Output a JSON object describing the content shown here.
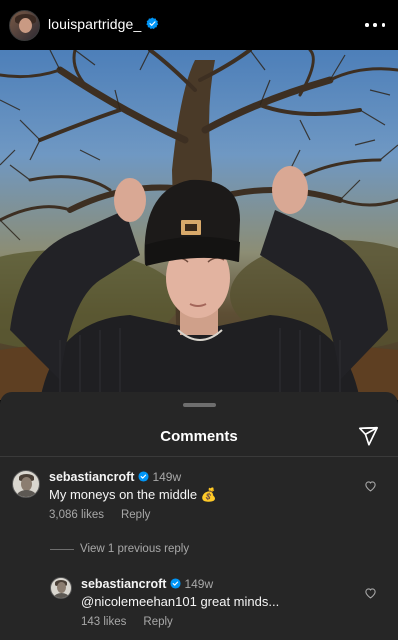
{
  "header": {
    "username": "louispartridge_",
    "verified_icon": "verified-badge-icon",
    "more_icon": "more-options-icon"
  },
  "post": {
    "image": "photo of person in dark knit beanie and sweater under bare tree"
  },
  "comments_sheet": {
    "title": "Comments",
    "share_icon": "send-icon",
    "accent_color": "#0095f6",
    "comments": [
      {
        "username": "sebastiancroft",
        "time": "149w",
        "text": "My moneys on the middle 💰",
        "likes": "3,086 likes",
        "reply_label": "Reply"
      }
    ],
    "view_replies_label": "View 1 previous reply",
    "replies": [
      {
        "username": "sebastiancroft",
        "time": "149w",
        "text": "@nicolemeehan101 great minds...",
        "likes": "143 likes",
        "reply_label": "Reply"
      }
    ]
  }
}
